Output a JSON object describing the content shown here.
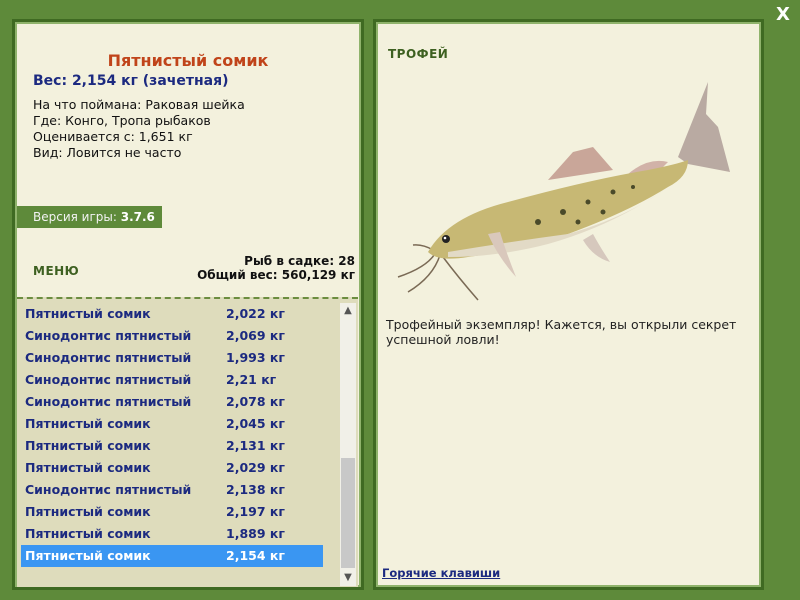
{
  "window": {
    "close_label": "X"
  },
  "fish": {
    "title": "Пятнистый сомик",
    "weight_line": "Вес: 2,154 кг (зачетная)",
    "details": [
      "На что поймана: Раковая шейка",
      "Где: Конго, Тропа рыбаков",
      "Оценивается с: 1,651 кг",
      "Вид: Ловится не часто"
    ]
  },
  "version": {
    "label": "Версия игры:",
    "value": "3.7.6"
  },
  "menu": {
    "label": "МЕНЮ"
  },
  "stats": {
    "fish_count": "Рыб в садке: 28",
    "total_weight": "Общий вес: 560,129 кг"
  },
  "catch_list": [
    {
      "name": "Пятнистый сомик",
      "weight": "2,022 кг"
    },
    {
      "name": "Синодонтис пятнистый",
      "weight": "2,069 кг"
    },
    {
      "name": "Синодонтис пятнистый",
      "weight": "1,993 кг"
    },
    {
      "name": "Синодонтис пятнистый",
      "weight": "2,21 кг"
    },
    {
      "name": "Синодонтис пятнистый",
      "weight": "2,078 кг"
    },
    {
      "name": "Пятнистый сомик",
      "weight": "2,045 кг"
    },
    {
      "name": "Пятнистый сомик",
      "weight": "2,131 кг"
    },
    {
      "name": "Пятнистый сомик",
      "weight": "2,029 кг"
    },
    {
      "name": "Синодонтис пятнистый",
      "weight": "2,138 кг"
    },
    {
      "name": "Пятнистый сомик",
      "weight": "2,197 кг"
    },
    {
      "name": "Пятнистый сомик",
      "weight": "1,889 кг"
    },
    {
      "name": "Пятнистый сомик",
      "weight": "2,154 кг",
      "selected": true
    }
  ],
  "trophy": {
    "label": "ТРОФЕЙ",
    "message": "Трофейный экземпляр! Кажется, вы открыли секрет успешной ловли!"
  },
  "hotkeys": {
    "label": "Горячие клавиши"
  },
  "colors": {
    "background": "#5e8a3a",
    "panel": "#f3f1dd",
    "selected_row": "#3a96f2",
    "list_text": "#1c2a80",
    "title": "#c0441a"
  }
}
